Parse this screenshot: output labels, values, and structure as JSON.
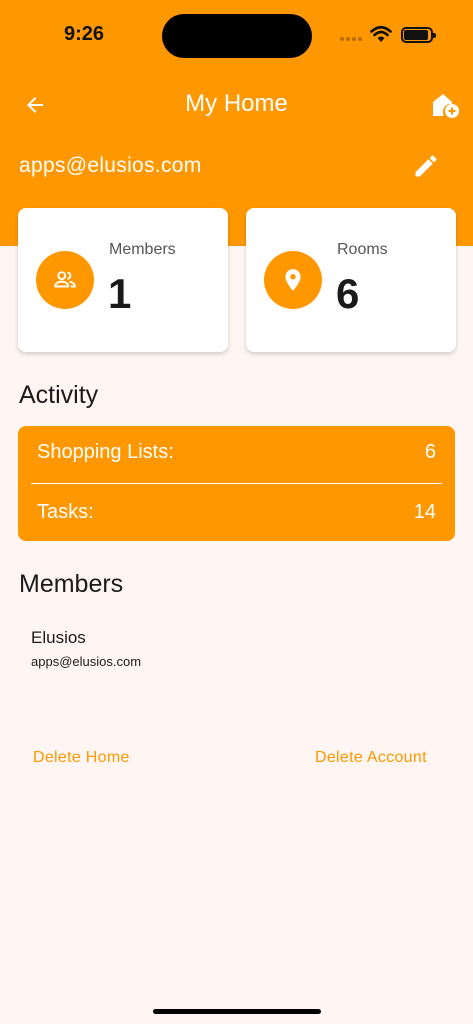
{
  "status_bar": {
    "time": "9:26"
  },
  "app_bar": {
    "title": "My Home",
    "back_icon": "arrow-back-icon",
    "action_icon": "add-home-icon"
  },
  "home": {
    "email": "apps@elusios.com",
    "edit_icon": "pencil-icon"
  },
  "stats": {
    "members": {
      "label": "Members",
      "value": "1",
      "icon": "group-icon"
    },
    "rooms": {
      "label": "Rooms",
      "value": "6",
      "icon": "location-pin-icon"
    }
  },
  "activity": {
    "title": "Activity",
    "rows": [
      {
        "label": "Shopping Lists:",
        "value": "6"
      },
      {
        "label": "Tasks:",
        "value": "14"
      }
    ]
  },
  "members": {
    "title": "Members",
    "items": [
      {
        "name": "Elusios",
        "email": "apps@elusios.com"
      }
    ]
  },
  "actions": {
    "delete_home": "Delete Home",
    "delete_account": "Delete Account"
  },
  "colors": {
    "accent": "#ff9800",
    "background": "#fff6f3",
    "text": "#1a1a1a"
  }
}
